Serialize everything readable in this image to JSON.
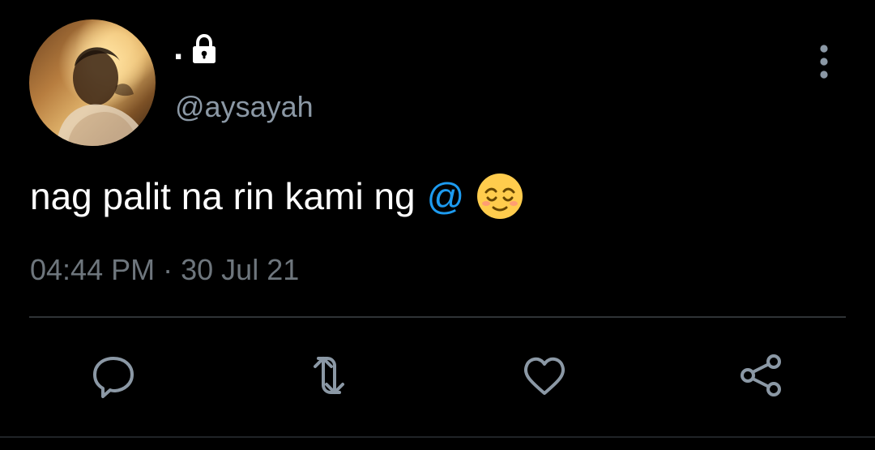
{
  "colors": {
    "background": "#000000",
    "primary_text": "#ffffff",
    "secondary_text": "#8b98a5",
    "timestamp_text": "#6e767d",
    "mention_blue": "#1d9bf0",
    "divider": "#2f3336",
    "action_icon": "#8b98a5"
  },
  "author": {
    "display_name": ".",
    "handle": "@aysayah",
    "protected_icon": "lock-icon",
    "avatar": "profile-photo"
  },
  "tweet": {
    "text": "nag palit na rin kami ng",
    "mention": "@",
    "emoji": "relieved-face-emoji"
  },
  "meta": {
    "time": "04:44 PM",
    "separator": "·",
    "date": "30 Jul 21"
  },
  "actions": [
    {
      "icon": "reply-icon"
    },
    {
      "icon": "retweet-icon"
    },
    {
      "icon": "like-icon"
    },
    {
      "icon": "share-icon"
    }
  ],
  "menu": {
    "icon": "more-options-icon"
  }
}
